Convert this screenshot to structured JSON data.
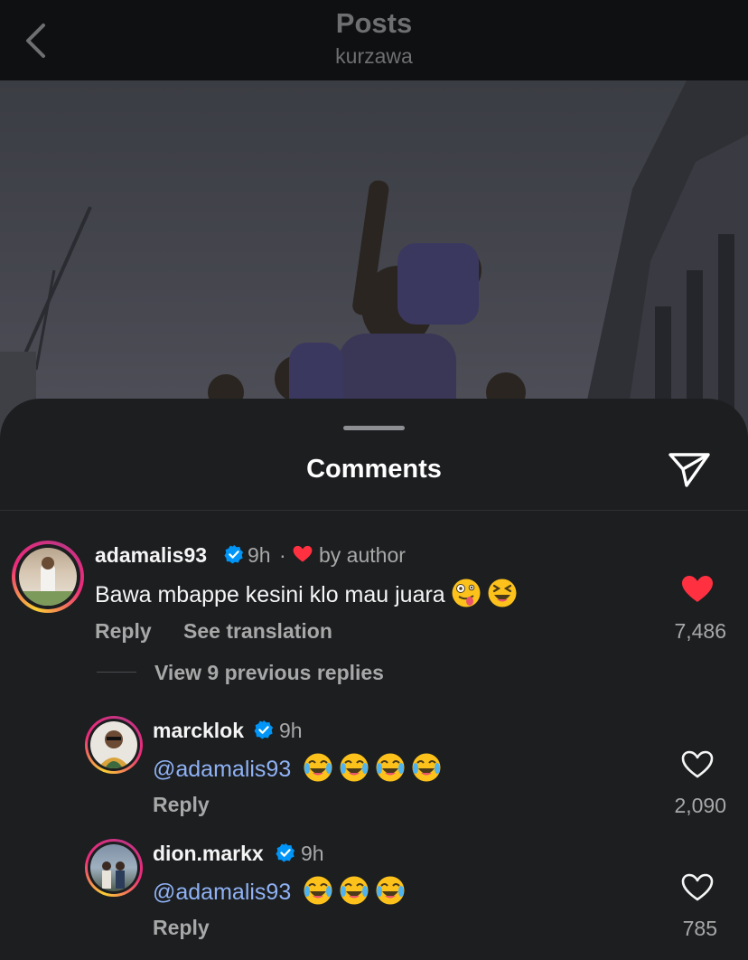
{
  "header": {
    "title": "Posts",
    "subtitle": "kurzawa",
    "back_icon": "chevron-left-icon"
  },
  "photo": {
    "description_icon": "post-photo"
  },
  "sheet": {
    "title": "Comments",
    "share_icon": "paper-plane-icon"
  },
  "comments": [
    {
      "username": "adamalis93",
      "verified": true,
      "time": "9h",
      "separator": "·",
      "liked_by_author": "by author",
      "text": "Bawa mbappe kesini klo mau juara",
      "emojis": [
        "zany-face",
        "laughing-squint"
      ],
      "reply_label": "Reply",
      "translate_label": "See translation",
      "likes": "7,486",
      "liked": true
    },
    {
      "username": "marcklok",
      "verified": true,
      "time": "9h",
      "mention": "@adamalis93",
      "emojis": [
        "joy",
        "joy",
        "joy",
        "joy"
      ],
      "reply_label": "Reply",
      "likes": "2,090",
      "liked": false
    },
    {
      "username": "dion.markx",
      "verified": true,
      "time": "9h",
      "mention": "@adamalis93",
      "emojis": [
        "joy",
        "joy",
        "joy"
      ],
      "reply_label": "Reply",
      "likes": "785",
      "liked": false
    }
  ],
  "view_replies": "View 9 previous replies",
  "colors": {
    "background": "#1c1e20",
    "mention": "#8fb2f5",
    "heart_liked": "#ff3040",
    "verified": "#0095f6",
    "muted": "#a8a8a8"
  }
}
